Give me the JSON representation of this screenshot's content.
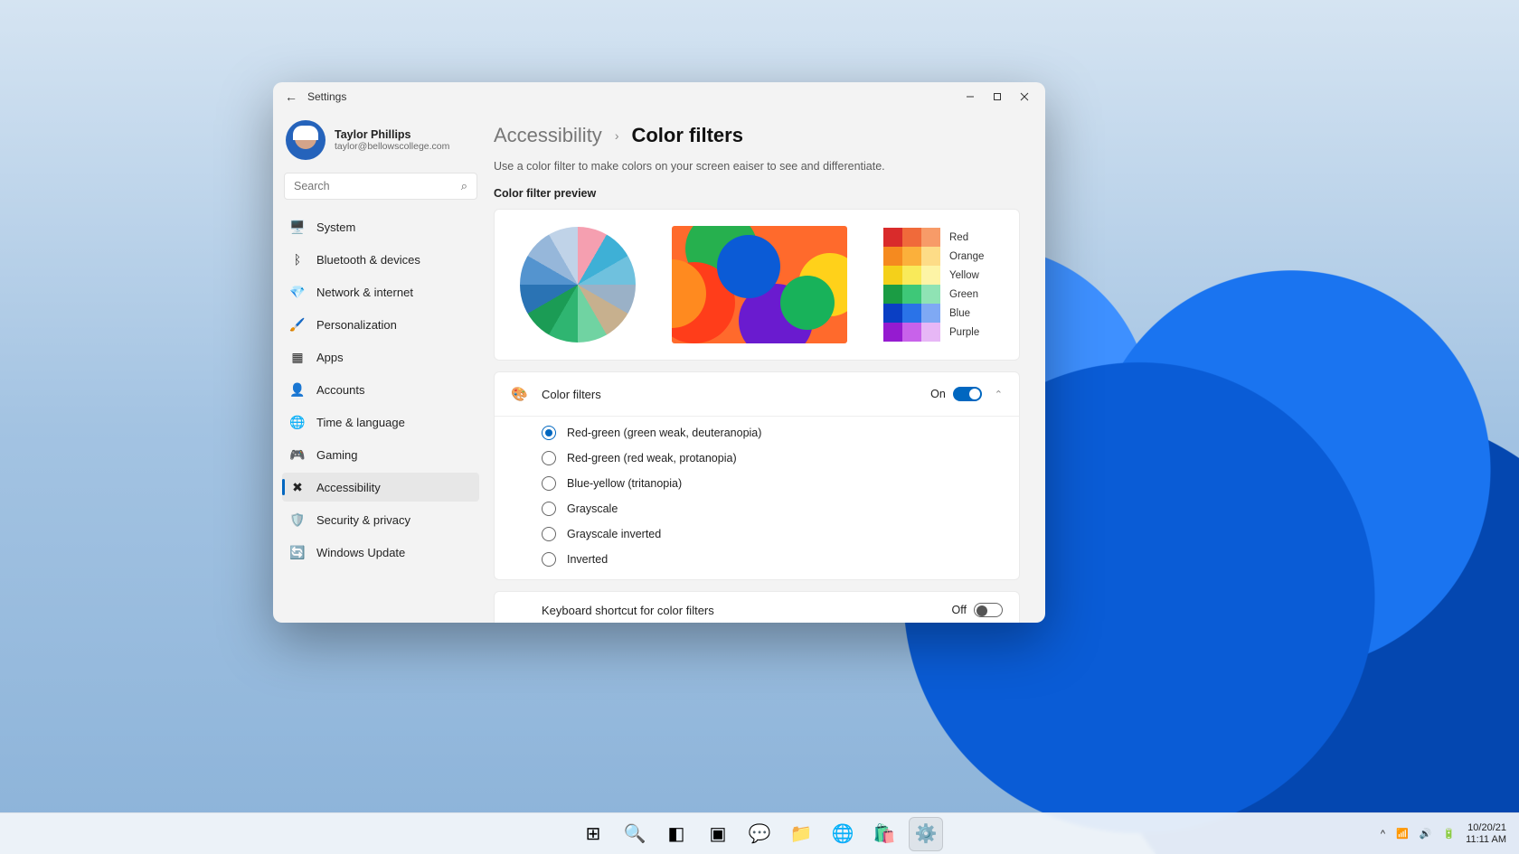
{
  "window": {
    "app_title": "Settings"
  },
  "user": {
    "name": "Taylor Phillips",
    "email": "taylor@bellowscollege.com"
  },
  "search": {
    "placeholder": "Search"
  },
  "sidebar": {
    "items": [
      {
        "label": "System",
        "icon": "🖥️",
        "icon_name": "system-icon"
      },
      {
        "label": "Bluetooth & devices",
        "icon": "ᛒ",
        "icon_name": "bluetooth-icon"
      },
      {
        "label": "Network & internet",
        "icon": "💎",
        "icon_name": "network-icon"
      },
      {
        "label": "Personalization",
        "icon": "🖌️",
        "icon_name": "personalization-icon"
      },
      {
        "label": "Apps",
        "icon": "▦",
        "icon_name": "apps-icon"
      },
      {
        "label": "Accounts",
        "icon": "👤",
        "icon_name": "accounts-icon"
      },
      {
        "label": "Time & language",
        "icon": "🌐",
        "icon_name": "time-language-icon"
      },
      {
        "label": "Gaming",
        "icon": "🎮",
        "icon_name": "gaming-icon"
      },
      {
        "label": "Accessibility",
        "icon": "✖",
        "icon_name": "accessibility-icon",
        "active": true
      },
      {
        "label": "Security & privacy",
        "icon": "🛡️",
        "icon_name": "privacy-icon"
      },
      {
        "label": "Windows Update",
        "icon": "🔄",
        "icon_name": "update-icon"
      }
    ]
  },
  "breadcrumb": {
    "parent": "Accessibility",
    "sep": "›",
    "current": "Color filters"
  },
  "description": "Use a color filter to make colors on your screen eaiser to see and differentiate.",
  "preview_label": "Color filter preview",
  "swatches": [
    {
      "label": "Red",
      "colors": [
        "#d92b2b",
        "#f06a3a",
        "#f79b68"
      ]
    },
    {
      "label": "Orange",
      "colors": [
        "#f58a1f",
        "#fbb03b",
        "#fddc87"
      ]
    },
    {
      "label": "Yellow",
      "colors": [
        "#f4d01a",
        "#f9ea5a",
        "#fdf4a6"
      ]
    },
    {
      "label": "Green",
      "colors": [
        "#1b9c44",
        "#3ec878",
        "#8fe3b4"
      ]
    },
    {
      "label": "Blue",
      "colors": [
        "#0a3fc4",
        "#2a73e8",
        "#7fa9f4"
      ]
    },
    {
      "label": "Purple",
      "colors": [
        "#951bd0",
        "#c862ea",
        "#e7b7f6"
      ]
    }
  ],
  "filters": {
    "title": "Color filters",
    "state": "On",
    "options": [
      {
        "label": "Red-green (green weak, deuteranopia)",
        "checked": true
      },
      {
        "label": "Red-green (red weak, protanopia)"
      },
      {
        "label": "Blue-yellow (tritanopia)"
      },
      {
        "label": "Grayscale"
      },
      {
        "label": "Grayscale inverted"
      },
      {
        "label": "Inverted"
      }
    ]
  },
  "shortcut": {
    "title": "Keyboard shortcut for color filters",
    "state": "Off"
  },
  "taskbar": {
    "icons": [
      {
        "glyph": "⊞",
        "name": "start-icon"
      },
      {
        "glyph": "🔍",
        "name": "search-icon"
      },
      {
        "glyph": "◧",
        "name": "taskview-icon"
      },
      {
        "glyph": "▣",
        "name": "widgets-icon"
      },
      {
        "glyph": "💬",
        "name": "chat-icon"
      },
      {
        "glyph": "📁",
        "name": "explorer-icon"
      },
      {
        "glyph": "🌐",
        "name": "edge-icon"
      },
      {
        "glyph": "🛍️",
        "name": "store-icon"
      },
      {
        "glyph": "⚙️",
        "name": "settings-app-icon",
        "active": true
      }
    ]
  },
  "tray": {
    "date": "10/20/21",
    "time": "11:11 AM"
  }
}
